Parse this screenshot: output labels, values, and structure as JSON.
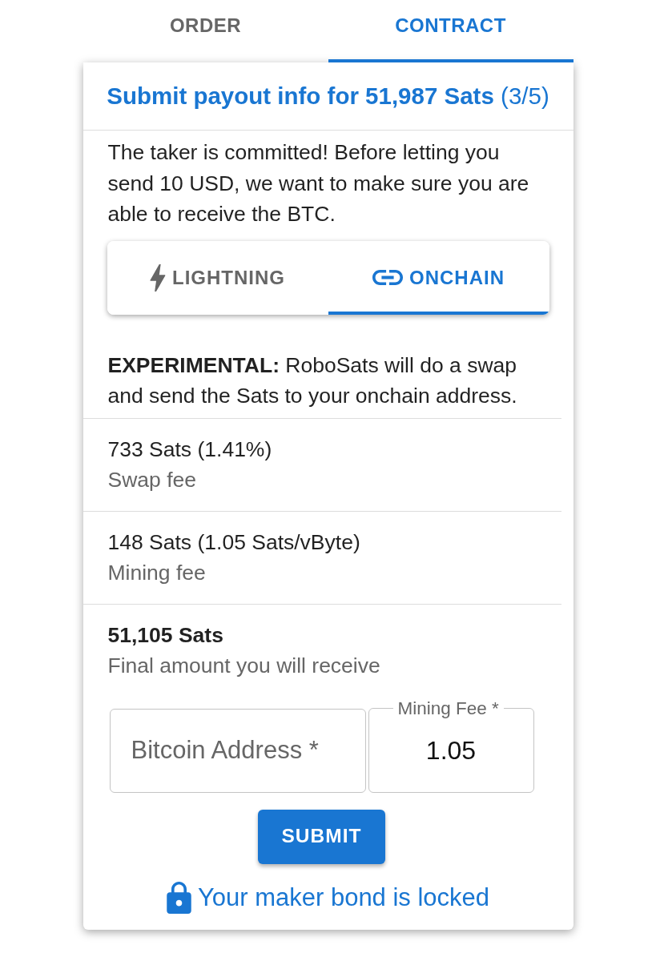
{
  "tabs": [
    {
      "label": "ORDER",
      "selected": false
    },
    {
      "label": "CONTRACT",
      "selected": true
    }
  ],
  "card": {
    "title": "**Submit payout info for 51,987 Sats** (3/5)",
    "intro": "The taker is committed! Before letting you send 10 USD, we want to make sure you are able to receive the BTC.",
    "method_tabs": [
      {
        "kind": "lightning",
        "label": "LIGHTNING",
        "selected": false
      },
      {
        "kind": "onchain",
        "label": "ONCHAIN",
        "selected": true
      }
    ],
    "note": "**EXPERIMENTAL:** RoboSats will do a swap and send the Sats to your onchain address.",
    "summary": [
      {
        "primary": "733 Sats (1.41%)",
        "secondary": "Swap fee",
        "bold": false
      },
      {
        "primary": "148 Sats (1.05 Sats/vByte)",
        "secondary": "Mining fee",
        "bold": false
      },
      {
        "primary": "51,105 Sats",
        "secondary": "Final amount you will receive",
        "bold": true
      }
    ],
    "fields": [
      {
        "kind": "plain",
        "placeholder": "Bitcoin Address *"
      },
      {
        "kind": "labelled",
        "label": "Mining Fee *",
        "value": "1.05"
      }
    ],
    "submit": "SUBMIT",
    "bond_status": "Your maker bond is locked"
  }
}
